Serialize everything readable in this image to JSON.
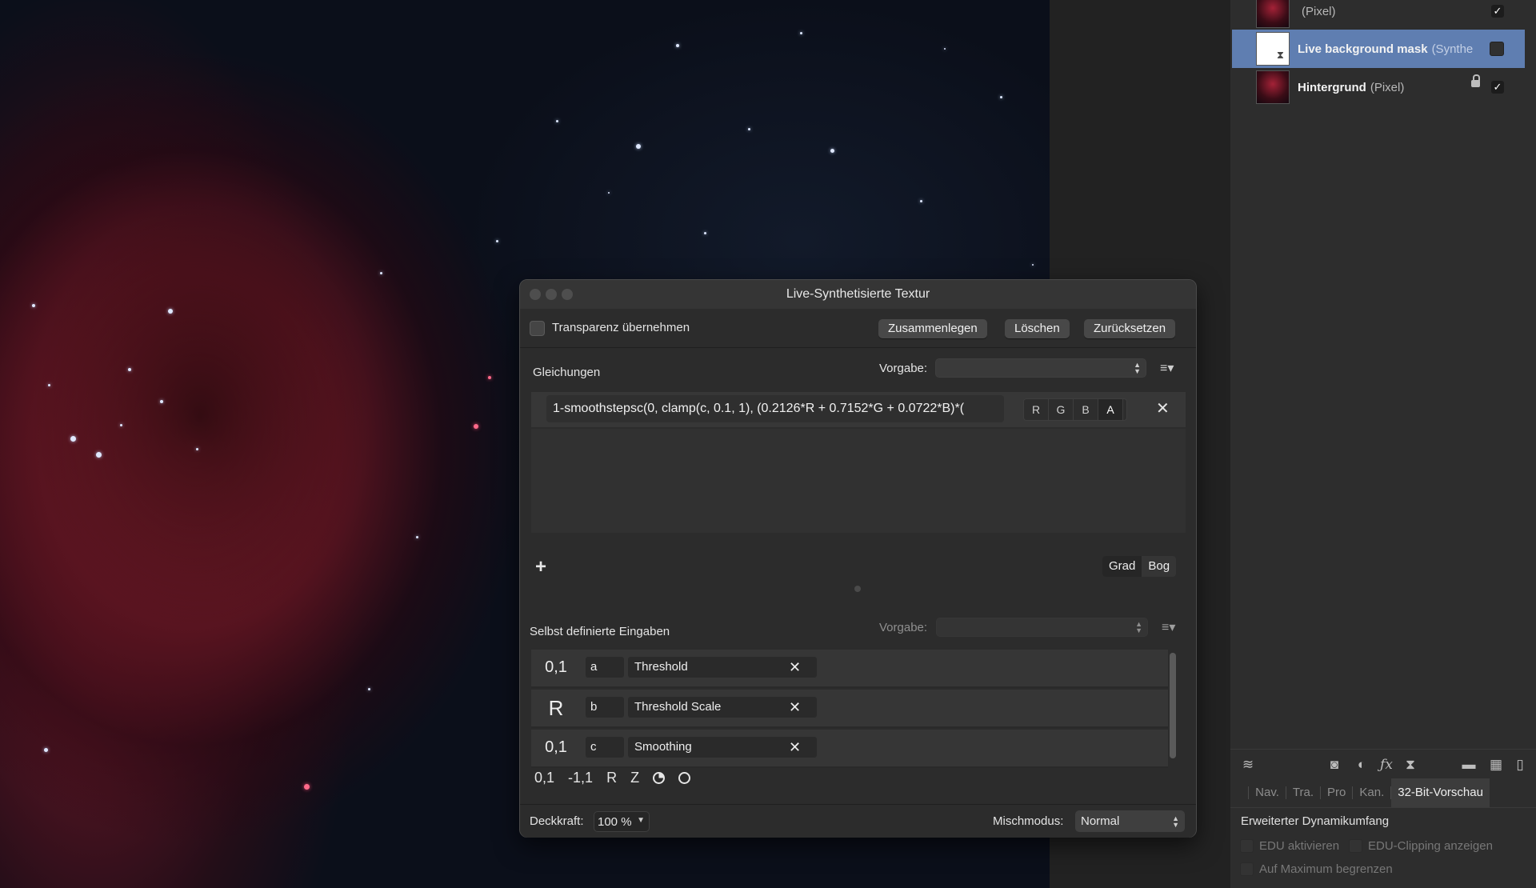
{
  "layers": [
    {
      "name": "",
      "type": "(Pixel)",
      "visible": true,
      "selected": false,
      "thumbnail": "nebula"
    },
    {
      "name": "Live background mask",
      "type": "(Synthe",
      "visible": false,
      "selected": true,
      "thumbnail": "mask"
    },
    {
      "name": "Hintergrund",
      "type": "(Pixel)",
      "visible": true,
      "selected": false,
      "locked": true,
      "thumbnail": "nebula"
    }
  ],
  "panel_toolbar_icons": [
    "layers-icon",
    "mask-icon",
    "adjustment-icon",
    "fx-icon",
    "live-filter-icon",
    "folder-icon",
    "checker-icon",
    "trash-icon"
  ],
  "panel_tabs": [
    "Nav.",
    "Tra.",
    "Pro",
    "Kan.",
    "32-Bit-Vorschau"
  ],
  "panel_tab_active": "32-Bit-Vorschau",
  "hdr": {
    "section_title": "Erweiterter Dynamikumfang",
    "opt1": "EDU aktivieren",
    "opt2": "EDU-Clipping anzeigen",
    "opt3": "Auf Maximum begrenzen"
  },
  "dialog": {
    "title": "Live-Synthetisierte Textur",
    "transparency_label": "Transparenz übernehmen",
    "btn_merge": "Zusammenlegen",
    "btn_delete": "Löschen",
    "btn_reset": "Zurücksetzen",
    "equations_label": "Gleichungen",
    "preset_label": "Vorgabe:",
    "equation": "1-smoothstepsc(0, clamp(c, 0.1, 1), (0.2126*R + 0.7152*G + 0.0722*B)*(",
    "channels": [
      "R",
      "G",
      "B",
      "A"
    ],
    "active_channel": "A",
    "plus": "+",
    "unit_deg": "Grad",
    "unit_rad": "Bog",
    "inputs_label": "Selbst definierte Eingaben",
    "inputs_preset_label": "Vorgabe:",
    "inputs": [
      {
        "type": "0,1",
        "var": "a",
        "name": "Threshold"
      },
      {
        "type": "R",
        "var": "b",
        "name": "Threshold Scale"
      },
      {
        "type": "0,1",
        "var": "c",
        "name": "Smoothing"
      }
    ],
    "input_types": [
      "0,1",
      "-1,1",
      "R",
      "Z"
    ],
    "opacity_label": "Deckkraft:",
    "opacity_value": "100 %",
    "blend_label": "Mischmodus:",
    "blend_value": "Normal"
  },
  "colors": {
    "selection": "#5f7eb1",
    "dialog_bg": "#2c2c2c",
    "panel_bg": "#2d2d2d"
  }
}
